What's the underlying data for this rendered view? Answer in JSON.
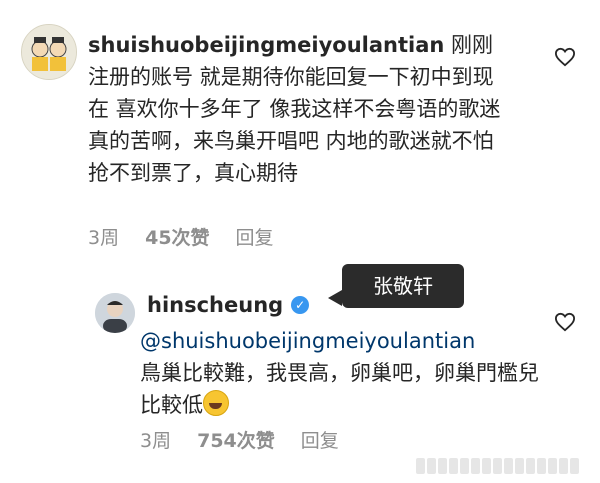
{
  "comment1": {
    "username": "shuishuobeijingmeiyoulantian",
    "text": " 刚刚注册的账号 就是期待你能回复一下初中到现在 喜欢你十多年了 像我这样不会粤语的歌迷真的苦啊，来鸟巢开唱吧 内地的歌迷就不怕抢不到票了，真心期待",
    "time": "3周",
    "likes": "45次赞",
    "reply": "回复"
  },
  "annotation": {
    "label": "张敬轩"
  },
  "comment2": {
    "username": "hinscheung",
    "mention": "@shuishuobeijingmeiyoulantian",
    "text": "鳥巢比較難，我畏高，卵巢吧，卵巢門檻兒比較低",
    "emoji": "rolling-on-floor-laughing",
    "time": "3周",
    "likes": "754次赞",
    "reply": "回复"
  },
  "colors": {
    "text": "#262626",
    "meta": "#8e8e8e",
    "verified": "#3897f0",
    "mention": "#00376b"
  }
}
